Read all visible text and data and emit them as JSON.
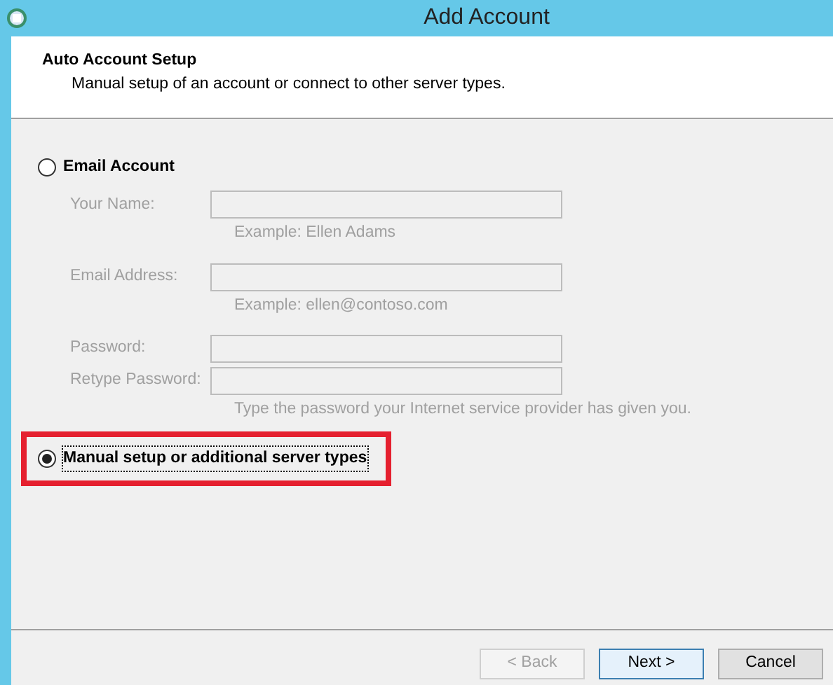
{
  "window": {
    "title": "Add Account"
  },
  "header": {
    "title": "Auto Account Setup",
    "subtitle": "Manual setup of an account or connect to other server types."
  },
  "options": [
    {
      "label": "Email Account",
      "selected": false,
      "highlighted": false,
      "fields": [
        {
          "label": "Your Name:",
          "hint": "Example: Ellen Adams",
          "disabled": true
        },
        {
          "label": "Email Address:",
          "hint": "Example: ellen@contoso.com",
          "disabled": true
        },
        {
          "label": "Password:",
          "disabled": true
        },
        {
          "label": "Retype Password:",
          "hint": "Type the password your Internet service provider has given you.",
          "disabled": true
        }
      ]
    },
    {
      "label": "Manual setup or additional server types",
      "selected": true,
      "highlighted": true
    }
  ],
  "buttons": [
    {
      "label": "< Back",
      "disabled": true,
      "default": false
    },
    {
      "label": "Next >",
      "disabled": false,
      "default": true
    },
    {
      "label": "Cancel",
      "disabled": false,
      "default": false
    }
  ]
}
